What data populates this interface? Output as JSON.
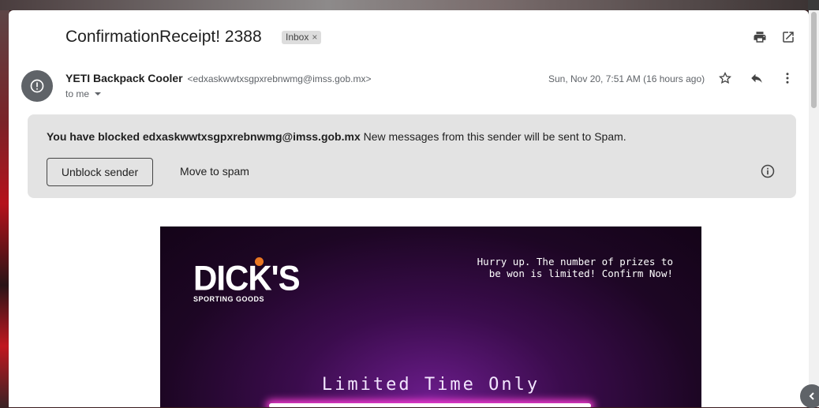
{
  "email": {
    "subject": "ConfirmationReceipt! 2388",
    "label": "Inbox",
    "label_remove": "×",
    "sender_name": "YETI Backpack Cooler",
    "sender_email": "<edxaskwwtxsgpxrebnwmg@imss.gob.mx>",
    "recipient": "to me",
    "date": "Sun, Nov 20, 7:51 AM (16 hours ago)"
  },
  "toolbar": {
    "print_icon": "print-icon",
    "open_new_window_icon": "open-in-new-icon",
    "star_icon": "star-icon",
    "reply_icon": "reply-icon",
    "more_icon": "more-vert-icon"
  },
  "blocked_notice": {
    "lead": "You have blocked edxaskwwtxsgpxrebnwmg@imss.gob.mx",
    "rest": " New messages from this sender will be sent to Spam.",
    "unblock_label": "Unblock sender",
    "move_spam_label": "Move to spam"
  },
  "promo": {
    "logo_main": "DICK'S",
    "logo_sub": "SPORTING GOODS",
    "hurry_text": "Hurry up. The number of prizes to be won is limited! Confirm Now!",
    "limited_text": "Limited Time Only"
  },
  "colors": {
    "avatar": "#5f6368",
    "blocked_bg": "#e3e3e3",
    "promo_bg": "#1d0624",
    "neon": "#ff3fd8"
  }
}
